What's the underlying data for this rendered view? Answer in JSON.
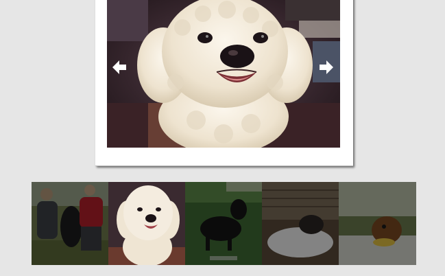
{
  "gallery": {
    "main_image": {
      "subject": "white-poodle-photo"
    },
    "prev_button": {
      "icon": "arrow-left-icon"
    },
    "next_button": {
      "icon": "arrow-right-icon"
    },
    "thumbnails": [
      {
        "subject": "two-people-with-dog-photo",
        "active": false
      },
      {
        "subject": "white-poodle-photo",
        "active": true
      },
      {
        "subject": "black-setter-dog-photo",
        "active": false
      },
      {
        "subject": "dog-on-white-blanket-photo",
        "active": false
      },
      {
        "subject": "brown-dog-outdoors-photo",
        "active": false
      }
    ]
  },
  "colors": {
    "background": "#e6e6e6",
    "frame": "#ffffff",
    "poodle_fur": "#f3ece0",
    "photo_dark": "#2b1b1f"
  }
}
